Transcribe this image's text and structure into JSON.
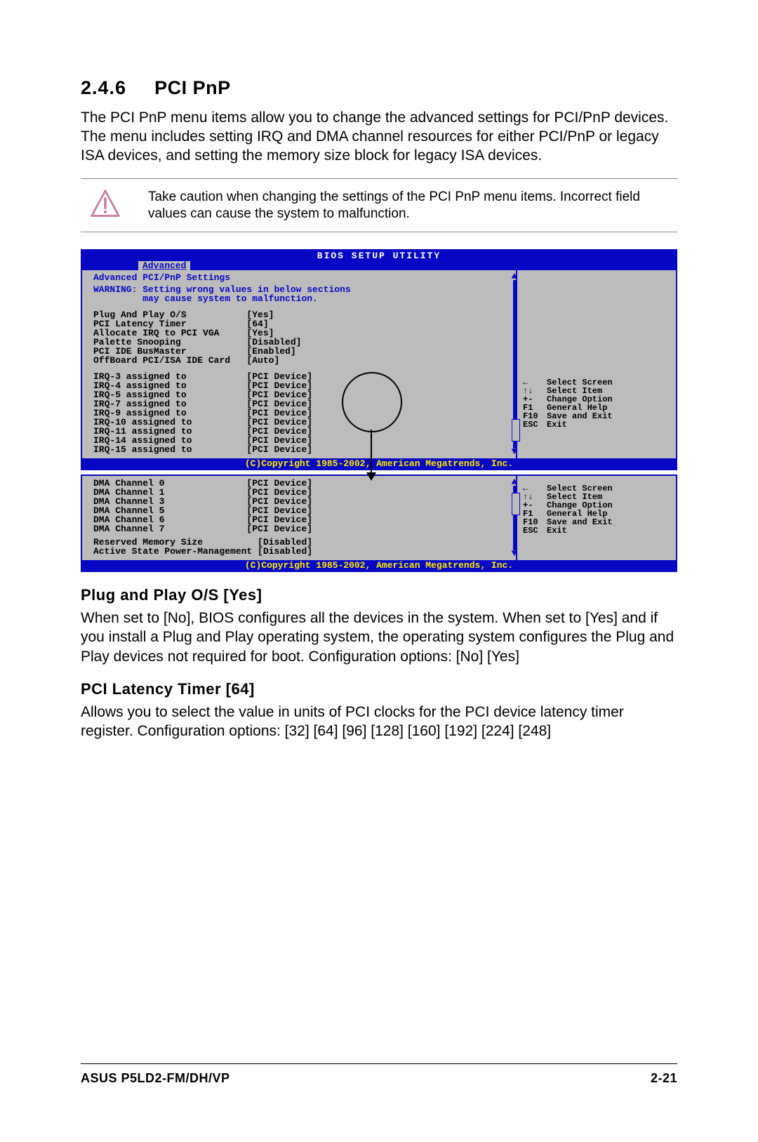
{
  "section": {
    "number": "2.4.6",
    "title": "PCI PnP"
  },
  "intro": "The PCI PnP menu items allow you to change the advanced settings for PCI/PnP devices. The menu includes setting IRQ and DMA channel resources for either PCI/PnP or legacy ISA devices, and setting the memory size block for legacy ISA devices.",
  "caution": "Take caution when changing the settings of the PCI PnP menu items. Incorrect field values can cause the system to malfunction.",
  "bios": {
    "title": "BIOS SETUP UTILITY",
    "tab": "Advanced",
    "heading": "Advanced PCI/PnP Settings",
    "warning1": "WARNING: Setting wrong values in below sections",
    "warning2": "         may cause system to malfunction.",
    "top_items": [
      {
        "label": "Plug And Play O/S",
        "value": "[Yes]"
      },
      {
        "label": "PCI Latency Timer",
        "value": "[64]"
      },
      {
        "label": "Allocate IRQ to PCI VGA",
        "value": "[Yes]"
      },
      {
        "label": "Palette Snooping",
        "value": "[Disabled]"
      },
      {
        "label": "PCI IDE BusMaster",
        "value": "[Enabled]"
      },
      {
        "label": "OffBoard PCI/ISA IDE Card",
        "value": "[Auto]"
      }
    ],
    "irq_items": [
      {
        "label": "IRQ-3 assigned to",
        "value": "[PCI Device]"
      },
      {
        "label": "IRQ-4 assigned to",
        "value": "[PCI Device]"
      },
      {
        "label": "IRQ-5 assigned to",
        "value": "[PCI Device]"
      },
      {
        "label": "IRQ-7 assigned to",
        "value": "[PCI Device]"
      },
      {
        "label": "IRQ-9 assigned to",
        "value": "[PCI Device]"
      },
      {
        "label": "IRQ-10 assigned to",
        "value": "[PCI Device]"
      },
      {
        "label": "IRQ-11 assigned to",
        "value": "[PCI Device]"
      },
      {
        "label": "IRQ-14 assigned to",
        "value": "[PCI Device]"
      },
      {
        "label": "IRQ-15 assigned to",
        "value": "[PCI Device]"
      }
    ],
    "dma_items": [
      {
        "label": "DMA Channel 0",
        "value": "[PCI Device]"
      },
      {
        "label": "DMA Channel 1",
        "value": "[PCI Device]"
      },
      {
        "label": "DMA Channel 3",
        "value": "[PCI Device]"
      },
      {
        "label": "DMA Channel 5",
        "value": "[PCI Device]"
      },
      {
        "label": "DMA Channel 6",
        "value": "[PCI Device]"
      },
      {
        "label": "DMA Channel 7",
        "value": "[PCI Device]"
      }
    ],
    "bottom_items": [
      {
        "label": "Reserved Memory Size",
        "value": "[Disabled]"
      },
      {
        "label": "Active State Power-Management",
        "value": "[Disabled]"
      }
    ],
    "nav": [
      {
        "sym": "←",
        "label": "Select Screen"
      },
      {
        "sym": "↑↓",
        "label": "Select Item"
      },
      {
        "sym": "+-",
        "label": "Change Option"
      },
      {
        "sym": "F1",
        "label": "General Help"
      },
      {
        "sym": "F10",
        "label": "Save and Exit"
      },
      {
        "sym": "ESC",
        "label": "Exit"
      }
    ],
    "copyright": "(C)Copyright 1985-2002, American Megatrends, Inc."
  },
  "sub1": {
    "title": "Plug and Play O/S [Yes]",
    "body": "When set to [No], BIOS configures all the devices in the system. When set to [Yes] and if you install a Plug and Play operating system, the operating system configures the Plug and Play devices not required for boot. Configuration options: [No] [Yes]"
  },
  "sub2": {
    "title": "PCI Latency Timer [64]",
    "body": "Allows you to select the value in units of PCI clocks for the PCI device latency timer register. Configuration options: [32] [64] [96] [128] [160] [192] [224] [248]"
  },
  "footer": {
    "left": "ASUS P5LD2-FM/DH/VP",
    "right": "2-21"
  }
}
